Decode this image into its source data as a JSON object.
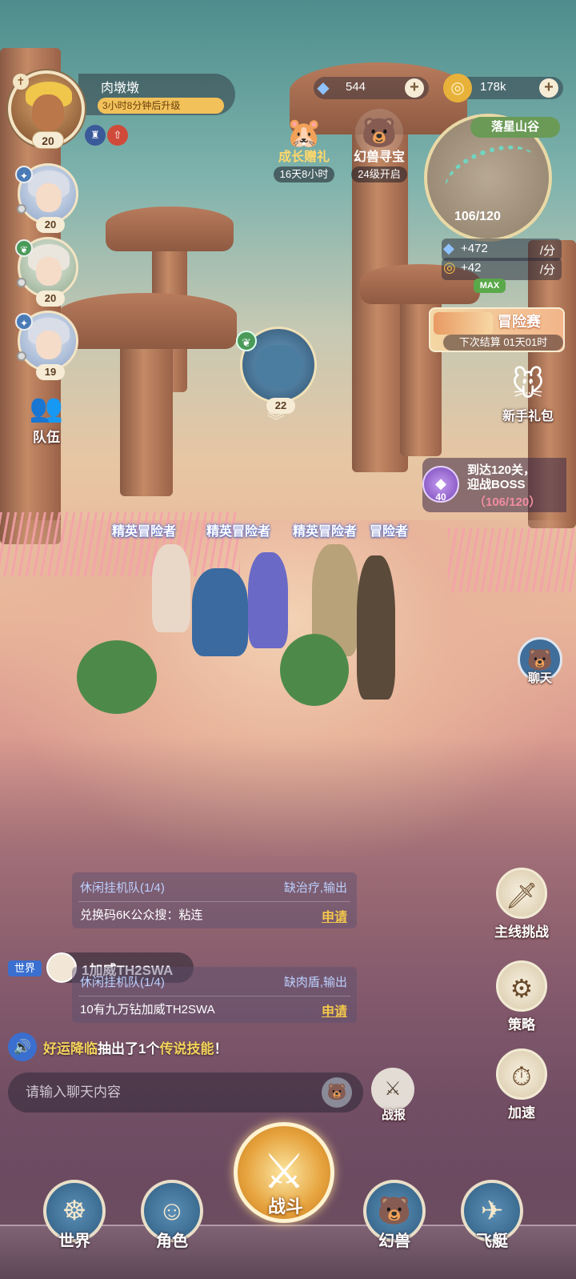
{
  "player": {
    "name": "肉墩墩",
    "level": "20",
    "upgrade_timer": "3小时8分钟后升级"
  },
  "party": [
    {
      "level": "20"
    },
    {
      "level": "20"
    },
    {
      "level": "19"
    }
  ],
  "team_label": "队伍",
  "currency": {
    "diamonds": "544",
    "gold": "178k"
  },
  "events": {
    "growth_gift": {
      "title": "成长赠礼",
      "sub": "16天8小时"
    },
    "beast_hunt": {
      "title": "幻兽寻宝",
      "sub": "24级开启"
    }
  },
  "map": {
    "name": "落星山谷",
    "progress": "106/120",
    "rate1": "+472",
    "rate2": "+42",
    "unit": "/分",
    "max_badge": "MAX"
  },
  "adventure": {
    "title": "冒险赛",
    "sub": "下次结算  01天01时"
  },
  "newbie_gift": "新手礼包",
  "boss": {
    "gem_count": "40",
    "line1": "到达120关，",
    "line2": "迎战BOSS",
    "line3": "（106/120）"
  },
  "pet": {
    "level": "22"
  },
  "elite_tags": [
    "精英冒险者",
    "精英冒险者",
    "精英冒险者",
    "冒险者"
  ],
  "chat": {
    "cards": [
      {
        "team": "休闲挂机队(1/4)",
        "need": "缺治疗,输出",
        "msg": "兑换码6K公众搜：粘连",
        "action": "申请"
      },
      {
        "team": "休闲挂机队(1/4)",
        "need": "缺肉盾,输出",
        "msg": "10有九万钻加威TH2SWA",
        "action": "申请"
      }
    ],
    "world_tag": "世界",
    "speaker_name": "1加威TH2SWA",
    "announce_lead": "好运降临",
    "announce_mid": "抽出了1个",
    "announce_gold": "传说技能",
    "announce_end": "！",
    "input_placeholder": "请输入聊天内容",
    "report_label": "战报",
    "side_label": "聊天"
  },
  "right_buttons": {
    "main_challenge": "主线挑战",
    "strategy": "策略",
    "speed_up": "加速"
  },
  "nav": {
    "world": "世界",
    "character": "角色",
    "fight": "战斗",
    "beast": "幻兽",
    "airship": "飞艇"
  }
}
